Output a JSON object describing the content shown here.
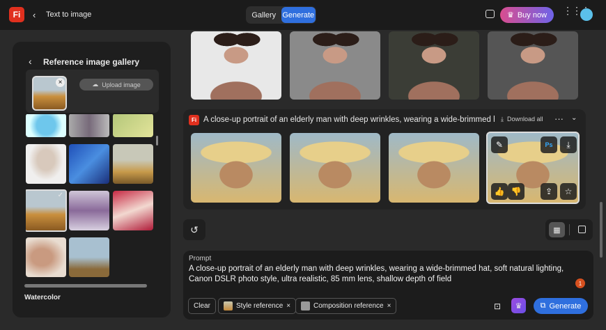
{
  "topbar": {
    "logo": "Fi",
    "back_label": "Text to image",
    "tabs": [
      {
        "label": "Gallery"
      },
      {
        "label": "Generate"
      }
    ],
    "buy_label": "Buy now"
  },
  "gallery": {
    "title": "Reference image gallery",
    "upload_label": "Upload image",
    "style_label": "Watercolor"
  },
  "results": {
    "logo": "Fi",
    "prompt_title": "A close-up portrait of an elderly man with deep wrinkles, wearing a wide-brimmed hat, sof",
    "download_all": "Download all",
    "ps_badge": "Ps"
  },
  "prompt": {
    "label": "Prompt",
    "text": "A close-up portrait of an elderly man with deep wrinkles, wearing a wide-brimmed hat, soft natural lighting, Canon DSLR photo style, ultra realistic, 85 mm lens, shallow depth of field",
    "badge_count": "1",
    "clear_label": "Clear",
    "style_ref_label": "Style reference",
    "comp_ref_label": "Composition reference",
    "generate_label": "Generate"
  }
}
